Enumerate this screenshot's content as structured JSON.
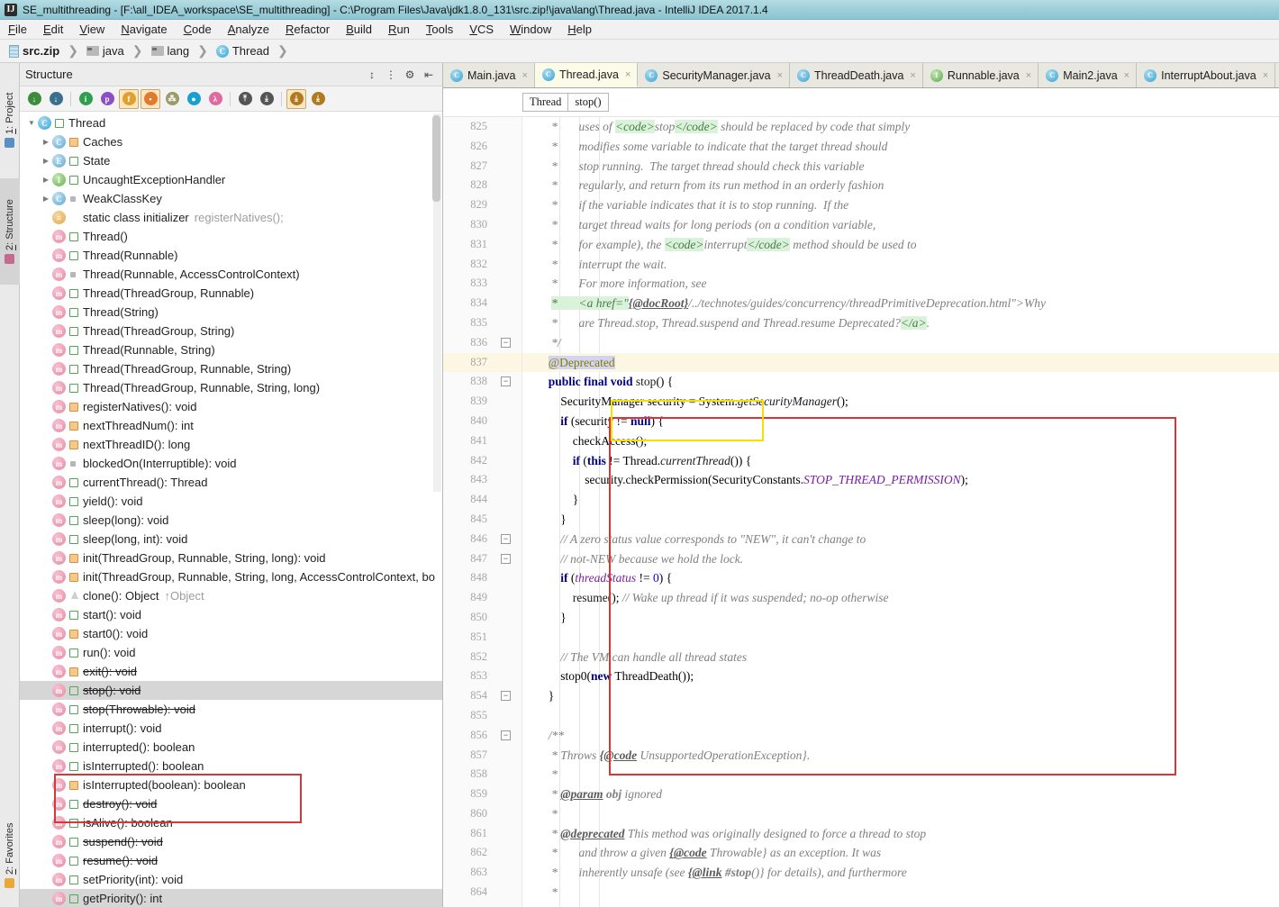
{
  "window": {
    "icon": "intellij-icon",
    "title": "SE_multithreading - [F:\\all_IDEA_workspace\\SE_multithreading] - C:\\Program Files\\Java\\jdk1.8.0_131\\src.zip!\\java\\lang\\Thread.java - IntelliJ IDEA 2017.1.4"
  },
  "menu": [
    "File",
    "Edit",
    "View",
    "Navigate",
    "Code",
    "Analyze",
    "Refactor",
    "Build",
    "Run",
    "Tools",
    "VCS",
    "Window",
    "Help"
  ],
  "navbar": [
    {
      "label": "src.zip",
      "icon": "zip-icon",
      "bold": true
    },
    {
      "label": "java",
      "icon": "folder-icon",
      "bold": false
    },
    {
      "label": "lang",
      "icon": "folder-icon",
      "bold": false
    },
    {
      "label": "Thread",
      "icon": "class-icon",
      "bold": false
    }
  ],
  "left_strip": [
    {
      "label": "1: Project",
      "accel": "1",
      "icon": "project-icon",
      "active": false
    },
    {
      "label": "2: Structure",
      "accel": "2",
      "icon": "structure-icon",
      "active": true
    },
    {
      "label": "2: Favorites",
      "accel": "2",
      "icon": "star-icon",
      "active": false
    }
  ],
  "structure": {
    "title": "Structure",
    "header_buttons": [
      "expand-all-icon",
      "collapse-all-icon",
      "settings-icon",
      "hide-icon"
    ],
    "toolbar": [
      {
        "name": "sort-by-visibility-icon",
        "glyph": "↓",
        "pressed": false
      },
      {
        "name": "sort-alphabetically-icon",
        "glyph": "↓",
        "pressed": false
      },
      {
        "name": "show-inherited-icon",
        "glyph": "i",
        "pressed": false
      },
      {
        "name": "show-properties-icon",
        "glyph": "p",
        "pressed": false
      },
      {
        "name": "show-fields-icon",
        "glyph": "f",
        "pressed": true
      },
      {
        "name": "show-non-public-icon",
        "glyph": "▪",
        "pressed": true
      },
      {
        "name": "show-anonymous-classes-icon",
        "glyph": "⁂",
        "pressed": false
      },
      {
        "name": "group-methods-icon",
        "glyph": "●",
        "pressed": false
      },
      {
        "name": "show-lambdas-icon",
        "glyph": "λ",
        "pressed": false
      },
      {
        "name": "expand-all-icon",
        "glyph": "⤒",
        "pressed": false
      },
      {
        "name": "collapse-all-icon",
        "glyph": "⤓",
        "pressed": false
      },
      {
        "name": "autoscroll-to-source-icon",
        "glyph": "⤓",
        "pressed": true
      },
      {
        "name": "autoscroll-from-source-icon",
        "glyph": "⤓",
        "pressed": false
      }
    ],
    "tree": [
      {
        "indent": 0,
        "twig": "down",
        "icon": "class",
        "vis": "pub",
        "label": "Thread",
        "strike": false,
        "sub": ""
      },
      {
        "indent": 1,
        "twig": "right",
        "icon": "class2",
        "vis": "prv",
        "label": "Caches",
        "strike": false,
        "sub": ""
      },
      {
        "indent": 1,
        "twig": "right",
        "icon": "enum",
        "vis": "pub",
        "label": "State",
        "strike": false,
        "sub": ""
      },
      {
        "indent": 1,
        "twig": "right",
        "icon": "iface",
        "vis": "pub",
        "label": "UncaughtExceptionHandler",
        "strike": false,
        "sub": ""
      },
      {
        "indent": 1,
        "twig": "right",
        "icon": "class2",
        "vis": "pkg",
        "label": "WeakClassKey",
        "strike": false,
        "sub": ""
      },
      {
        "indent": 1,
        "twig": "",
        "icon": "init",
        "vis": "none",
        "label": "static class initializer",
        "strike": false,
        "sub": "registerNatives();"
      },
      {
        "indent": 1,
        "twig": "",
        "icon": "method",
        "vis": "pub",
        "label": "Thread()",
        "strike": false,
        "sub": ""
      },
      {
        "indent": 1,
        "twig": "",
        "icon": "method",
        "vis": "pub",
        "label": "Thread(Runnable)",
        "strike": false,
        "sub": ""
      },
      {
        "indent": 1,
        "twig": "",
        "icon": "method",
        "vis": "pkg",
        "label": "Thread(Runnable, AccessControlContext)",
        "strike": false,
        "sub": ""
      },
      {
        "indent": 1,
        "twig": "",
        "icon": "method",
        "vis": "pub",
        "label": "Thread(ThreadGroup, Runnable)",
        "strike": false,
        "sub": ""
      },
      {
        "indent": 1,
        "twig": "",
        "icon": "method",
        "vis": "pub",
        "label": "Thread(String)",
        "strike": false,
        "sub": ""
      },
      {
        "indent": 1,
        "twig": "",
        "icon": "method",
        "vis": "pub",
        "label": "Thread(ThreadGroup, String)",
        "strike": false,
        "sub": ""
      },
      {
        "indent": 1,
        "twig": "",
        "icon": "method",
        "vis": "pub",
        "label": "Thread(Runnable, String)",
        "strike": false,
        "sub": ""
      },
      {
        "indent": 1,
        "twig": "",
        "icon": "method",
        "vis": "pub",
        "label": "Thread(ThreadGroup, Runnable, String)",
        "strike": false,
        "sub": ""
      },
      {
        "indent": 1,
        "twig": "",
        "icon": "method",
        "vis": "pub",
        "label": "Thread(ThreadGroup, Runnable, String, long)",
        "strike": false,
        "sub": ""
      },
      {
        "indent": 1,
        "twig": "",
        "icon": "method-static",
        "vis": "prv",
        "label": "registerNatives(): void",
        "strike": false,
        "sub": ""
      },
      {
        "indent": 1,
        "twig": "",
        "icon": "method-static",
        "vis": "prv",
        "label": "nextThreadNum(): int",
        "strike": false,
        "sub": ""
      },
      {
        "indent": 1,
        "twig": "",
        "icon": "method-static",
        "vis": "prv",
        "label": "nextThreadID(): long",
        "strike": false,
        "sub": ""
      },
      {
        "indent": 1,
        "twig": "",
        "icon": "method",
        "vis": "pkg",
        "label": "blockedOn(Interruptible): void",
        "strike": false,
        "sub": ""
      },
      {
        "indent": 1,
        "twig": "",
        "icon": "method-static",
        "vis": "pub",
        "label": "currentThread(): Thread",
        "strike": false,
        "sub": ""
      },
      {
        "indent": 1,
        "twig": "",
        "icon": "method-static",
        "vis": "pub",
        "label": "yield(): void",
        "strike": false,
        "sub": ""
      },
      {
        "indent": 1,
        "twig": "",
        "icon": "method-static",
        "vis": "pub",
        "label": "sleep(long): void",
        "strike": false,
        "sub": ""
      },
      {
        "indent": 1,
        "twig": "",
        "icon": "method-static",
        "vis": "pub",
        "label": "sleep(long, int): void",
        "strike": false,
        "sub": ""
      },
      {
        "indent": 1,
        "twig": "",
        "icon": "method",
        "vis": "prv",
        "label": "init(ThreadGroup, Runnable, String, long): void",
        "strike": false,
        "sub": ""
      },
      {
        "indent": 1,
        "twig": "",
        "icon": "method",
        "vis": "prv",
        "label": "init(ThreadGroup, Runnable, String, long, AccessControlContext, bo",
        "strike": false,
        "sub": ""
      },
      {
        "indent": 1,
        "twig": "",
        "icon": "method",
        "vis": "ovr",
        "label": "clone(): Object",
        "strike": false,
        "sub": "↑Object"
      },
      {
        "indent": 1,
        "twig": "",
        "icon": "method",
        "vis": "pub",
        "label": "start(): void",
        "strike": false,
        "sub": ""
      },
      {
        "indent": 1,
        "twig": "",
        "icon": "method",
        "vis": "prv",
        "label": "start0(): void",
        "strike": false,
        "sub": ""
      },
      {
        "indent": 1,
        "twig": "",
        "icon": "method",
        "vis": "pub",
        "label": "run(): void",
        "strike": false,
        "sub": ""
      },
      {
        "indent": 1,
        "twig": "",
        "icon": "method",
        "vis": "prv",
        "label": "exit(): void",
        "strike": true,
        "sub": ""
      },
      {
        "indent": 1,
        "twig": "",
        "icon": "method",
        "vis": "pub",
        "label": "stop(): void",
        "strike": true,
        "sub": "",
        "selected": true
      },
      {
        "indent": 1,
        "twig": "",
        "icon": "method",
        "vis": "pub",
        "label": "stop(Throwable): void",
        "strike": true,
        "sub": ""
      },
      {
        "indent": 1,
        "twig": "",
        "icon": "method",
        "vis": "pub",
        "label": "interrupt(): void",
        "strike": false,
        "sub": ""
      },
      {
        "indent": 1,
        "twig": "",
        "icon": "method-static",
        "vis": "pub",
        "label": "interrupted(): boolean",
        "strike": false,
        "sub": ""
      },
      {
        "indent": 1,
        "twig": "",
        "icon": "method",
        "vis": "pub",
        "label": "isInterrupted(): boolean",
        "strike": false,
        "sub": ""
      },
      {
        "indent": 1,
        "twig": "",
        "icon": "method",
        "vis": "prv",
        "label": "isInterrupted(boolean): boolean",
        "strike": false,
        "sub": ""
      },
      {
        "indent": 1,
        "twig": "",
        "icon": "method",
        "vis": "pub",
        "label": "destroy(): void",
        "strike": true,
        "sub": ""
      },
      {
        "indent": 1,
        "twig": "",
        "icon": "method",
        "vis": "pub",
        "label": "isAlive(): boolean",
        "strike": false,
        "sub": ""
      },
      {
        "indent": 1,
        "twig": "",
        "icon": "method",
        "vis": "pub",
        "label": "suspend(): void",
        "strike": true,
        "sub": ""
      },
      {
        "indent": 1,
        "twig": "",
        "icon": "method",
        "vis": "pub",
        "label": "resume(): void",
        "strike": true,
        "sub": ""
      },
      {
        "indent": 1,
        "twig": "",
        "icon": "method",
        "vis": "pub",
        "label": "setPriority(int): void",
        "strike": false,
        "sub": ""
      },
      {
        "indent": 1,
        "twig": "",
        "icon": "method",
        "vis": "pub",
        "label": "getPriority(): int",
        "strike": false,
        "sub": "",
        "hover": true
      }
    ]
  },
  "editor": {
    "tabs": [
      {
        "label": "Main.java",
        "icon": "class",
        "active": false
      },
      {
        "label": "Thread.java",
        "icon": "class",
        "active": true
      },
      {
        "label": "SecurityManager.java",
        "icon": "class",
        "active": false
      },
      {
        "label": "ThreadDeath.java",
        "icon": "class",
        "active": false
      },
      {
        "label": "Runnable.java",
        "icon": "iface",
        "active": false
      },
      {
        "label": "Main2.java",
        "icon": "class",
        "active": false
      },
      {
        "label": "InterruptAbout.java",
        "icon": "class",
        "active": false
      }
    ],
    "breadcrumb": [
      "Thread",
      "stop()"
    ],
    "first_line_number": 825,
    "lines": [
      {
        "n": 825,
        "fold": "",
        "html": "   <span class='cmt'>*       uses of </span><span class='cmt-hl'>&lt;code&gt;</span><span class='cmt'>stop</span><span class='cmt-hl'>&lt;/code&gt;</span><span class='cmt'> should be replaced by code that simply</span>"
      },
      {
        "n": 826,
        "fold": "",
        "html": "   <span class='cmt'>*       modifies some variable to indicate that the target thread should</span>"
      },
      {
        "n": 827,
        "fold": "",
        "html": "   <span class='cmt'>*       stop running.  The target thread should check this variable</span>"
      },
      {
        "n": 828,
        "fold": "",
        "html": "   <span class='cmt'>*       regularly, and return from its run method in an orderly fashion</span>"
      },
      {
        "n": 829,
        "fold": "",
        "html": "   <span class='cmt'>*       if the variable indicates that it is to stop running.  If the</span>"
      },
      {
        "n": 830,
        "fold": "",
        "html": "   <span class='cmt'>*       target thread waits for long periods (on a condition variable,</span>"
      },
      {
        "n": 831,
        "fold": "",
        "html": "   <span class='cmt'>*       for example), the </span><span class='cmt-hl'>&lt;code&gt;</span><span class='cmt'>interrupt</span><span class='cmt-hl'>&lt;/code&gt;</span><span class='cmt'> method should be used to</span>"
      },
      {
        "n": 832,
        "fold": "",
        "html": "   <span class='cmt'>*       interrupt the wait.</span>"
      },
      {
        "n": 833,
        "fold": "",
        "html": "   <span class='cmt'>*       For more information, see</span>"
      },
      {
        "n": 834,
        "fold": "",
        "html": "   <span class='cmt-hl'>*       &lt;a href=\"</span><span class='cmt-tag'>{@docRoot}</span><span class='cmt'>/../technotes/guides/concurrency/threadPrimitiveDeprecation.html\"&gt;Why</span>"
      },
      {
        "n": 835,
        "fold": "",
        "html": "   <span class='cmt'>*       are Thread.stop, Thread.suspend and Thread.resume Deprecated?</span><span class='cmt-hl'>&lt;/a&gt;</span><span class='cmt'>.</span>"
      },
      {
        "n": 836,
        "fold": "minus",
        "html": "   <span class='cmt'>*/</span>"
      },
      {
        "n": 837,
        "fold": "",
        "hl": true,
        "html": "  <span class='anno selbg'>@Deprecated</span>"
      },
      {
        "n": 838,
        "fold": "minus",
        "html": "  <span class='kw'>public final void</span> <span class='ident'>stop</span>() {"
      },
      {
        "n": 839,
        "fold": "",
        "html": "      SecurityManager security = System.<span class='smeth'>getSecurityManager</span>();"
      },
      {
        "n": 840,
        "fold": "",
        "html": "      <span class='kw'>if</span> (security != <span class='kw'>null</span>) {"
      },
      {
        "n": 841,
        "fold": "",
        "html": "          checkAccess();"
      },
      {
        "n": 842,
        "fold": "",
        "html": "          <span class='kw'>if</span> (<span class='kw'>this</span> != Thread.<span class='smeth'>currentThread</span>()) {"
      },
      {
        "n": 843,
        "fold": "",
        "html": "              security.checkPermission(SecurityConstants.<span class='sfield'>STOP_THREAD_PERMISSION</span>);"
      },
      {
        "n": 844,
        "fold": "",
        "html": "          }"
      },
      {
        "n": 845,
        "fold": "",
        "html": "      }"
      },
      {
        "n": 846,
        "fold": "minus",
        "html": "      <span class='cmt'>// A zero status value corresponds to \"NEW\", it can't change to</span>"
      },
      {
        "n": 847,
        "fold": "minus",
        "html": "      <span class='cmt'>// not-NEW because we hold the lock.</span>"
      },
      {
        "n": 848,
        "fold": "",
        "html": "      <span class='kw'>if</span> (<span class='sfield'>threadStatus</span> != <span class='num'>0</span>) {"
      },
      {
        "n": 849,
        "fold": "",
        "html": "          <span class='ident'>resume</span>(); <span class='cmt'>// Wake up thread if it was suspended; no-op otherwise</span>"
      },
      {
        "n": 850,
        "fold": "",
        "html": "      }"
      },
      {
        "n": 851,
        "fold": "",
        "html": ""
      },
      {
        "n": 852,
        "fold": "",
        "html": "      <span class='cmt'>// The VM can handle all thread states</span>"
      },
      {
        "n": 853,
        "fold": "",
        "html": "      stop0(<span class='kw'>new</span> ThreadDeath());"
      },
      {
        "n": 854,
        "fold": "minus",
        "html": "  }"
      },
      {
        "n": 855,
        "fold": "",
        "html": ""
      },
      {
        "n": 856,
        "fold": "minus",
        "html": "  <span class='cmt'>/**</span>"
      },
      {
        "n": 857,
        "fold": "",
        "html": "   <span class='cmt'>* Throws </span><span class='cmt-tag'>{@code</span><span class='cmt'> UnsupportedOperationException}.</span>"
      },
      {
        "n": 858,
        "fold": "",
        "html": "   <span class='cmt'>*</span>"
      },
      {
        "n": 859,
        "fold": "",
        "html": "   <span class='cmt'>* </span><span class='cmt-tag'>@param</span><span class='cmt'> <b>obj</b> ignored</span>"
      },
      {
        "n": 860,
        "fold": "",
        "html": "   <span class='cmt'>*</span>"
      },
      {
        "n": 861,
        "fold": "",
        "html": "   <span class='cmt'>* </span><span class='cmt-tag'>@deprecated</span><span class='cmt'> This method was originally designed to force a thread to stop</span>"
      },
      {
        "n": 862,
        "fold": "",
        "html": "   <span class='cmt'>*       and throw a given </span><span class='cmt-tag'>{@code</span><span class='cmt'> Throwable} as an exception. It was</span>"
      },
      {
        "n": 863,
        "fold": "",
        "html": "   <span class='cmt'>*       inherently unsafe (see </span><span class='cmt-tag'>{@link</span><span class='cmt'> <b>#stop</b>()} for details), and furthermore</span>"
      },
      {
        "n": 864,
        "fold": "",
        "html": "   <span class='cmt'>*</span>"
      }
    ],
    "annotations": [
      {
        "name": "red-highlight-box",
        "color": "#d83636"
      },
      {
        "name": "yellow-highlight-box",
        "color": "#f5e100"
      }
    ]
  }
}
